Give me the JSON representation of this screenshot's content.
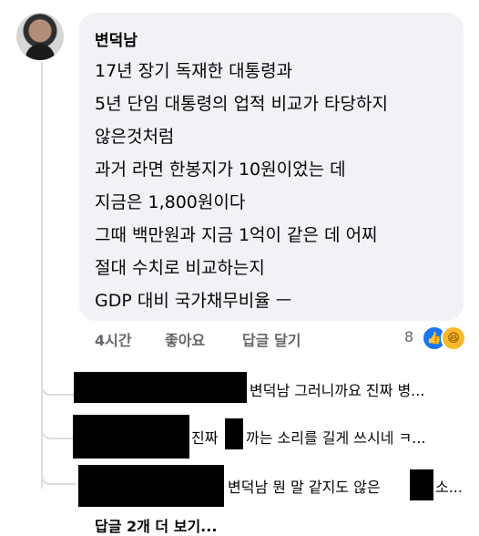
{
  "comment": {
    "author": "변덕남",
    "lines": [
      "17년 장기 독재한 대통령과",
      "5년 단임 대통령의 업적 비교가 타당하지",
      "않은것처럼",
      "과거 라면 한봉지가 10원이었는 데",
      "지금은 1,800원이다",
      "그때 백만원과 지금 1억이 같은 데 어찌",
      "절대 수치로 비교하는지",
      "GDP 대비 국가채무비율 ㅡ"
    ],
    "time": "4시간",
    "like_label": "좋아요",
    "reply_label": "답글 달기",
    "reaction_count": "8",
    "reaction_icons": [
      "like-icon",
      "haha-icon"
    ]
  },
  "replies": [
    {
      "text": "변덕남 그러니까요 진짜 병..."
    },
    {
      "text_a": "진짜",
      "text_b": "까는 소리를 길게 쓰시네 ㅋ..."
    },
    {
      "text_a": "변덕남  뭔 말 같지도 않은",
      "text_b": "소..."
    }
  ],
  "more_replies_label": "답글 2개 더 보기...",
  "colors": {
    "bubble": "#f0f2f5",
    "meta": "#65676b",
    "like": "#1877f2",
    "haha": "#f7b928"
  }
}
